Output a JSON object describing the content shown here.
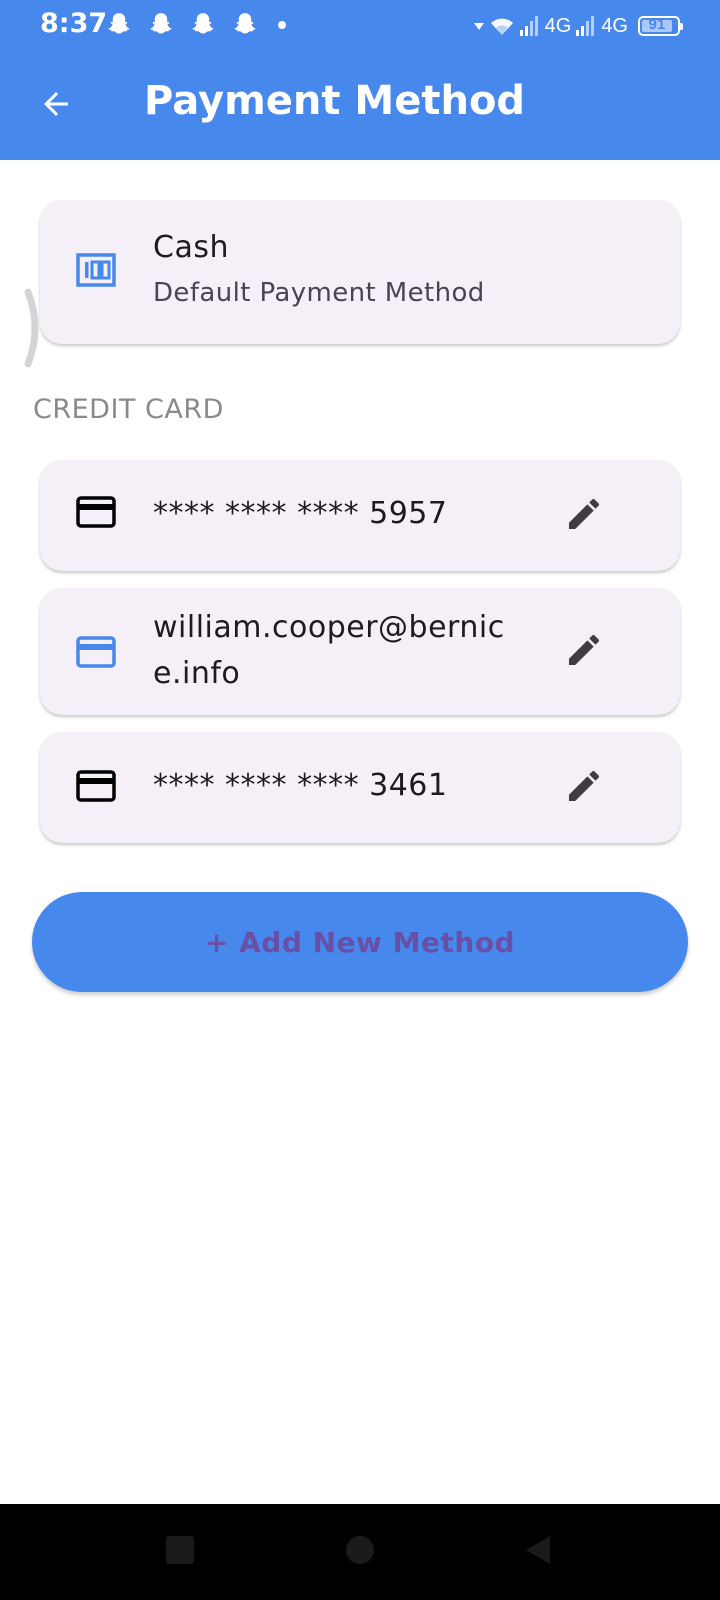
{
  "status_bar": {
    "time": "8:37",
    "network_1": "4G",
    "network_2": "4G",
    "battery": "91",
    "icons": [
      "snapchat-icon",
      "snapchat-icon",
      "snapchat-icon",
      "snapchat-icon",
      "dot-icon",
      "wifi-icon",
      "signal-icon",
      "signal-icon",
      "battery-icon"
    ]
  },
  "header": {
    "title": "Payment Method",
    "back_icon": "arrow-left-icon",
    "color": "#4788ec"
  },
  "default_method": {
    "icon": "cash-icon",
    "title": "Cash",
    "subtitle": "Default Payment Method"
  },
  "section": {
    "title": "CREDIT CARD"
  },
  "cards": [
    {
      "icon": "credit-card-icon",
      "label": "**** **** **** 5957",
      "edit_icon": "pencil-icon"
    },
    {
      "icon": "credit-card-icon",
      "label_line1": "william.cooper@bernic",
      "label_line2": "e.info",
      "edit_icon": "pencil-icon"
    },
    {
      "icon": "credit-card-icon",
      "label": "**** **** **** 3461",
      "edit_icon": "pencil-icon"
    }
  ],
  "add_button": {
    "label": "+ Add New Method"
  },
  "nav_bar": {
    "buttons": [
      "recents-square-icon",
      "home-circle-icon",
      "back-triangle-icon"
    ]
  },
  "colors": {
    "primary": "#4788ec",
    "card_bg": "#f5f0f7",
    "button_text": "#6a4fa5"
  }
}
